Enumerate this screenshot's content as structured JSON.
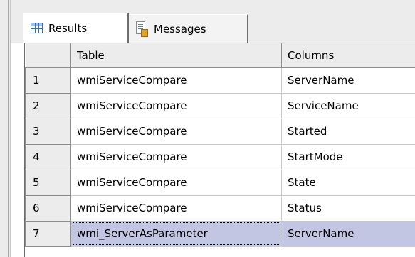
{
  "tabs": [
    {
      "label": "Results",
      "icon": "grid-icon",
      "active": true
    },
    {
      "label": "Messages",
      "icon": "messages-icon",
      "active": false
    }
  ],
  "grid": {
    "columns": [
      "",
      "Table",
      "Columns"
    ],
    "rows": [
      {
        "num": "1",
        "table": "wmiServiceCompare",
        "column": "ServerName"
      },
      {
        "num": "2",
        "table": "wmiServiceCompare",
        "column": "ServiceName"
      },
      {
        "num": "3",
        "table": "wmiServiceCompare",
        "column": "Started"
      },
      {
        "num": "4",
        "table": "wmiServiceCompare",
        "column": "StartMode"
      },
      {
        "num": "5",
        "table": "wmiServiceCompare",
        "column": "State"
      },
      {
        "num": "6",
        "table": "wmiServiceCompare",
        "column": "Status"
      },
      {
        "num": "7",
        "table": "wmi_ServerAsParameter",
        "column": "ServerName"
      }
    ],
    "selected_row": "7"
  },
  "colors": {
    "selection": "#c3c6e2",
    "header_bg": "#ececec",
    "frame": "#ececec"
  }
}
